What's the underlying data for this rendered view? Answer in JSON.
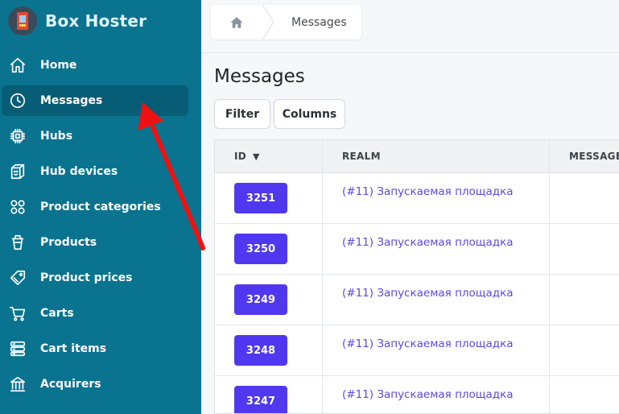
{
  "app": {
    "title": "Box Hoster",
    "logo_icon": "vending-machine-icon"
  },
  "sidebar": {
    "background": "#0a7390",
    "active_index": 1,
    "items": [
      {
        "label": "Home",
        "icon": "home-icon"
      },
      {
        "label": "Messages",
        "icon": "clock-icon"
      },
      {
        "label": "Hubs",
        "icon": "chip-icon"
      },
      {
        "label": "Hub devices",
        "icon": "box-face-icon"
      },
      {
        "label": "Product categories",
        "icon": "grid-circles-icon"
      },
      {
        "label": "Products",
        "icon": "cup-icon"
      },
      {
        "label": "Product prices",
        "icon": "price-tag-icon"
      },
      {
        "label": "Carts",
        "icon": "cart-icon"
      },
      {
        "label": "Cart items",
        "icon": "server-stack-icon"
      },
      {
        "label": "Acquirers",
        "icon": "bank-icon"
      }
    ]
  },
  "breadcrumb": {
    "home_icon": "home-icon",
    "current": "Messages"
  },
  "page": {
    "title": "Messages"
  },
  "toolbar": {
    "filter_label": "Filter",
    "columns_label": "Columns"
  },
  "table": {
    "columns": {
      "id": "ID",
      "id_sort": "▼",
      "realm": "REALM",
      "message": "MESSAGE I"
    },
    "rows": [
      {
        "id": "3251",
        "realm": "(#11) Запускаемая площадка"
      },
      {
        "id": "3250",
        "realm": "(#11) Запускаемая площадка"
      },
      {
        "id": "3249",
        "realm": "(#11) Запускаемая площадка"
      },
      {
        "id": "3248",
        "realm": "(#11) Запускаемая площадка"
      },
      {
        "id": "3247",
        "realm": "(#11) Запускаемая площадка"
      }
    ]
  },
  "colors": {
    "accent": "#5038f0",
    "link": "#5a4ae0",
    "annotation_arrow": "#ee1111"
  }
}
